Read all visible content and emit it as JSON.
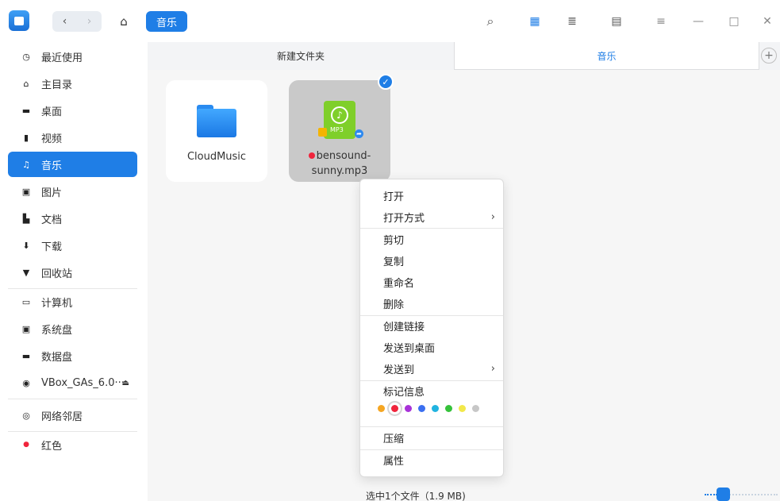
{
  "titlebar": {
    "back_icon": "‹",
    "forward_icon": "›",
    "home_icon": "⌂",
    "breadcrumb": "音乐",
    "search_icon": "⌕",
    "icon_view_icon": "▦",
    "list_view_icon": "≣",
    "detail_view_icon": "▤",
    "menu_icon": "≡",
    "minimize_icon": "—",
    "maximize_icon": "□",
    "close_icon": "✕"
  },
  "sidebar": {
    "items": [
      {
        "label": "最近使用",
        "icon": "◷"
      },
      {
        "label": "主目录",
        "icon": "⌂"
      },
      {
        "label": "桌面",
        "icon": "▬"
      },
      {
        "label": "视频",
        "icon": "▮"
      },
      {
        "label": "音乐",
        "icon": "♫"
      },
      {
        "label": "图片",
        "icon": "▣"
      },
      {
        "label": "文档",
        "icon": "▙"
      },
      {
        "label": "下载",
        "icon": "⬇"
      },
      {
        "label": "回收站",
        "icon": "▼"
      },
      {
        "label": "计算机",
        "icon": "▭"
      },
      {
        "label": "系统盘",
        "icon": "▣"
      },
      {
        "label": "数据盘",
        "icon": "▬"
      },
      {
        "label": "VBox_GAs_6.0···",
        "icon": "◉",
        "eject_icon": "⏏"
      },
      {
        "label": "网络邻居",
        "icon": "◎"
      },
      {
        "label": "红色",
        "icon": "●"
      }
    ]
  },
  "tabs": [
    {
      "label": "新建文件夹"
    },
    {
      "label": "音乐"
    }
  ],
  "tab_add_icon": "+",
  "files": [
    {
      "name": "CloudMusic"
    },
    {
      "name_line1": "bensound-",
      "name_line2": "sunny.mp3",
      "file_label": "MP3",
      "note_icon": "♪",
      "check_icon": "✓",
      "link_icon": "➦"
    }
  ],
  "context_menu": {
    "items": [
      {
        "label": "打开"
      },
      {
        "label": "打开方式",
        "arrow": "›"
      },
      {
        "label": "剪切"
      },
      {
        "label": "复制"
      },
      {
        "label": "重命名"
      },
      {
        "label": "删除"
      },
      {
        "label": "创建链接"
      },
      {
        "label": "发送到桌面"
      },
      {
        "label": "发送到",
        "arrow": "›"
      },
      {
        "label": "标记信息"
      },
      {
        "label": "压缩"
      },
      {
        "label": "属性"
      }
    ],
    "tag_colors": [
      "#f5a623",
      "#f0243c",
      "#a832d8",
      "#3b6ff0",
      "#21b3e0",
      "#35c23b",
      "#f2e84a",
      "#c7c7c7"
    ]
  },
  "status": {
    "text": "选中1个文件（1.9 MB)"
  },
  "colors": {
    "accent": "#1f7ee6",
    "red_tag": "#f0243c"
  }
}
